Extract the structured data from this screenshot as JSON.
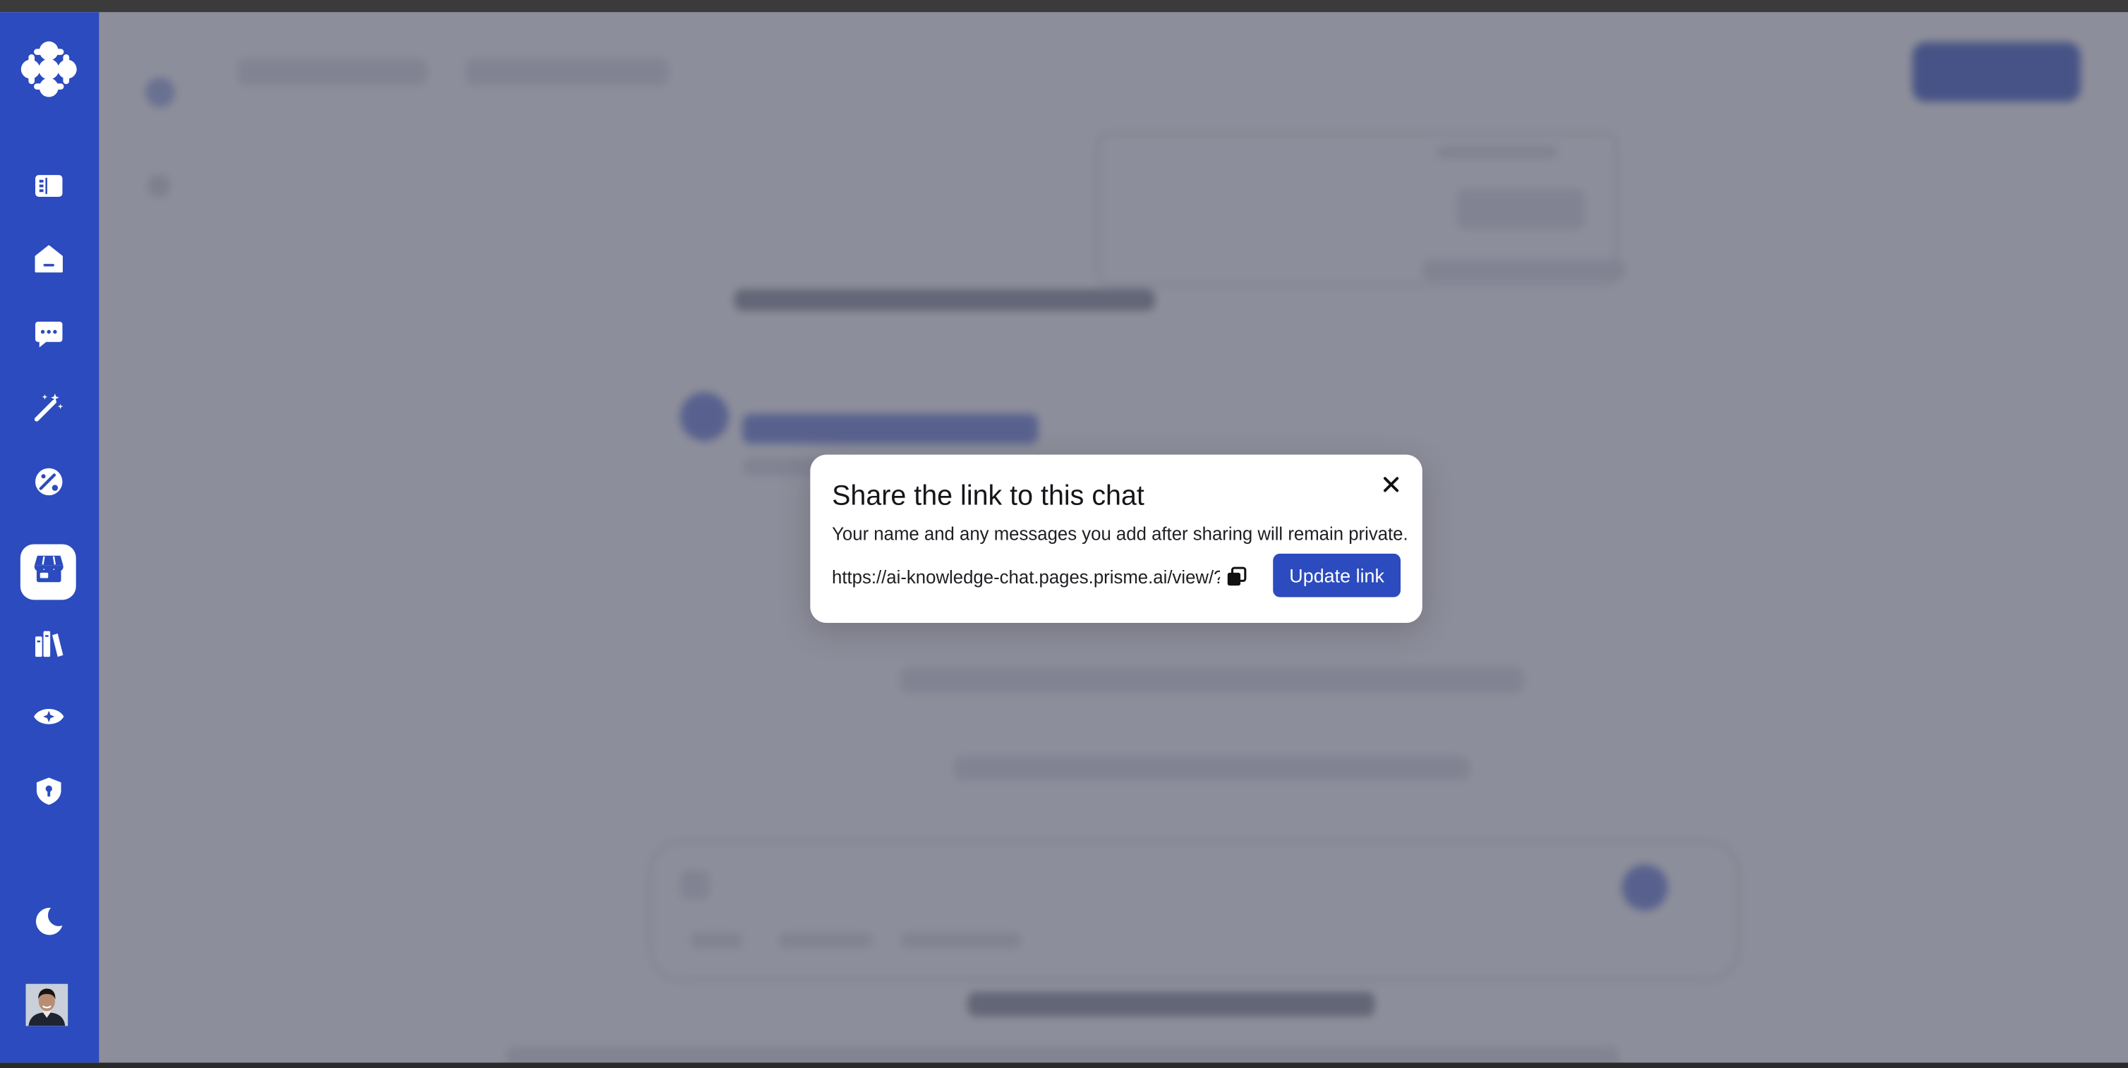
{
  "app": {
    "sidebar": {
      "logo_icon": "cbc-gem-logo",
      "items": [
        {
          "name": "dashboard",
          "icon": "dashboard-icon",
          "active": false
        },
        {
          "name": "home",
          "icon": "home-icon",
          "active": false
        },
        {
          "name": "chat",
          "icon": "chat-bubble-icon",
          "active": false
        },
        {
          "name": "magic",
          "icon": "magic-wand-icon",
          "active": false
        },
        {
          "name": "tools",
          "icon": "tools-icon",
          "active": false
        },
        {
          "name": "store",
          "icon": "store-icon",
          "active": true
        },
        {
          "name": "library",
          "icon": "library-icon",
          "active": false
        },
        {
          "name": "insights",
          "icon": "eye-icon",
          "active": false
        },
        {
          "name": "security",
          "icon": "shield-lock-icon",
          "active": false
        }
      ],
      "theme_toggle_icon": "moon-icon",
      "avatar_icon": "user-avatar"
    },
    "colors": {
      "sidebar": "#2b4bbe",
      "primary_button": "#2b4bbe",
      "overlay": "rgba(86,88,104,0.66)"
    }
  },
  "share_modal": {
    "title": "Share the link to this chat",
    "description": "Your name and any messages you add after sharing will remain private.",
    "link_value": "https://ai-knowledge-chat.pages.prisme.ai/view/?",
    "copy_icon": "copy-icon",
    "close_icon": "close-icon",
    "update_button_label": "Update link"
  }
}
